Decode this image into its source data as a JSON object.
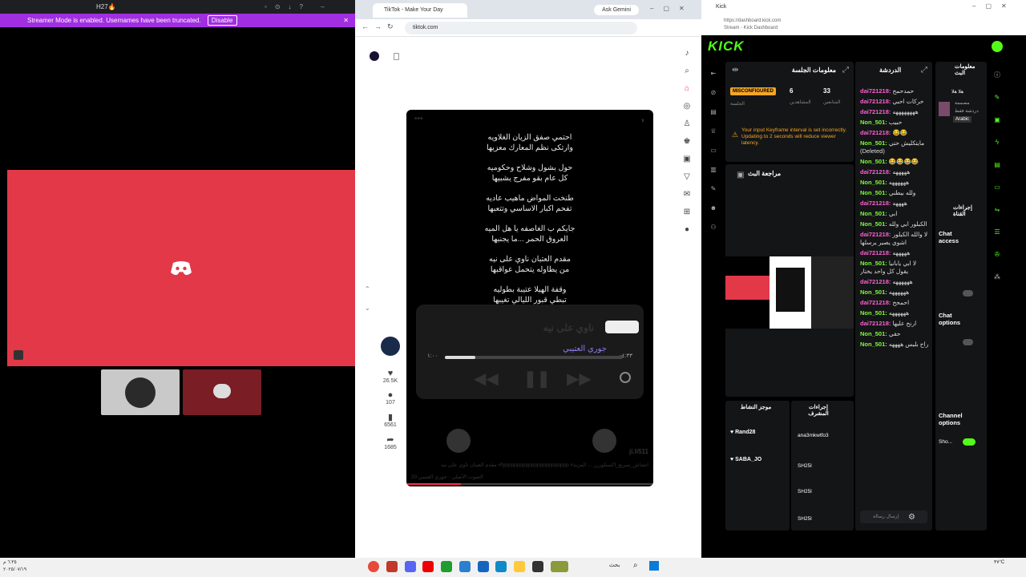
{
  "discord": {
    "window_title": "H27🔥",
    "streamer_text": "Streamer Mode is enabled. Usernames have been truncated.",
    "disable_label": "Disable"
  },
  "tiktok": {
    "tab_title": "TikTok - Make Your Day",
    "ask_gemini": "Ask Gemini",
    "url": "tiktok.com",
    "lyrics": [
      [
        "احتمي صفق الزيان الغلاويه",
        "وارتكى نظم المعارك معزيها"
      ],
      [
        "حول بشول وشلاح وحكوميه",
        "كل عام بقو مفرج يشبيها"
      ],
      [
        "طنخت المواض ماهيب عاديه",
        "تفحم اكبار الاساسي وتتعبها"
      ],
      [
        "جايكم ب الغاصفه يا هل الميه",
        "العروق الحمر ...ما يجنبها"
      ],
      [
        "مقدم العتبان ناوي على نيه",
        "من يطاوله يتحمل عواقبها"
      ],
      [
        "وقفة الهيلا عتيبة بطوليه",
        "تبطي قبور الليالي تغيبها"
      ]
    ],
    "song_title": "ناوي على نيه",
    "song_artist": "جوري العتيبي",
    "time_elapsed": "١:٠٠",
    "time_remaining": "-٤:٣٣",
    "handle": "ji.li511",
    "caption": "مقدم العتبان ناوي على نيه #fypppppppppppppppppppppp #اتشاش_سريع_اكسبلوررر ... المزيد",
    "sound": "الصوت الأصلي - جوري العتيبي 20",
    "likes": "26.5K",
    "comments": "107",
    "saves": "6561",
    "shares": "1685"
  },
  "kick": {
    "tab_title": "Kick",
    "url": "https://dashboard.kick.com",
    "page_title": "Stream - Kick Dashboard",
    "logo": "KICK",
    "session_title": "معلومات الجلسة",
    "misconfigured": "MISCONFIGURED",
    "session_label": "الجلسة",
    "followers_count": "6",
    "followers_label": "المشاهدين",
    "viewers_count": "33",
    "viewers_label": "المتابعين",
    "warning": "Your input Keyframe interval is set incorrectly. Updating to 2 seconds will reduce viewer latency.",
    "review_title": "مراجعة البث",
    "chat_title": "الدردشة",
    "stream_info_title": "معلومات البث",
    "stream_info_line1": "هلا هلا",
    "stream_info_line2": "مصممة",
    "stream_info_line3": "دردشة فقط",
    "lang": "Arabic",
    "chat": [
      {
        "user": "dai721218:",
        "text": "حمدحمح",
        "color": "#ff5fd2"
      },
      {
        "user": "dai721218:",
        "text": "حركات احبي",
        "color": "#ff5fd2"
      },
      {
        "user": "dai721218:",
        "text": "ههههههههه",
        "color": "#ff5fd2"
      },
      {
        "user": "Non_501:",
        "text": "حبيب",
        "color": "#7cfc3a"
      },
      {
        "user": "dai721218:",
        "text": "😂😂",
        "color": "#ff5fd2"
      },
      {
        "user": "Non_501:",
        "text": "مايتكليش حتي (Deleted)",
        "color": "#7cfc3a"
      },
      {
        "user": "Non_501:",
        "text": "😂😂😂😂",
        "color": "#7cfc3a"
      },
      {
        "user": "dai721218:",
        "text": "هههههه",
        "color": "#ff5fd2"
      },
      {
        "user": "Non_501:",
        "text": "ههههههه",
        "color": "#7cfc3a"
      },
      {
        "user": "Non_501:",
        "text": "ولله بيطني",
        "color": "#7cfc3a"
      },
      {
        "user": "dai721218:",
        "text": "ههههه",
        "color": "#ff5fd2"
      },
      {
        "user": "Non_501:",
        "text": "ابي",
        "color": "#7cfc3a"
      },
      {
        "user": "Non_501:",
        "text": "الكبلور ابي ولله",
        "color": "#7cfc3a"
      },
      {
        "user": "dai721218:",
        "text": "لا والله الكبلور اشوي يصير يرسلها",
        "color": "#ff5fd2"
      },
      {
        "user": "dai721218:",
        "text": "هههههه",
        "color": "#ff5fd2"
      },
      {
        "user": "Non_501:",
        "text": "لا ابي يابانيا يقول كل واحد يختار",
        "color": "#7cfc3a"
      },
      {
        "user": "dai721218:",
        "text": "ههههههه",
        "color": "#ff5fd2"
      },
      {
        "user": "Non_501:",
        "text": "ههههههه",
        "color": "#7cfc3a"
      },
      {
        "user": "dai721218:",
        "text": "احمحح",
        "color": "#ff5fd2"
      },
      {
        "user": "Non_501:",
        "text": "ههههههه",
        "color": "#7cfc3a"
      },
      {
        "user": "dai721218:",
        "text": "ارنح عليها",
        "color": "#ff5fd2"
      },
      {
        "user": "Non_501:",
        "text": "حقي",
        "color": "#7cfc3a"
      },
      {
        "user": "Non_501:",
        "text": "راح بليس ههههه",
        "color": "#7cfc3a"
      }
    ],
    "mod_actions_title": "إجراءات القناة",
    "chat_access": "Chat access",
    "chat_options": "Chat options",
    "channel_options": "Channel options",
    "show_label": "Sho...",
    "mod_col_title": "إجراءات المشرف",
    "users_col_title": "موجز النشاط",
    "mod_users": [
      "ana3mkwtfo3",
      "SH25l",
      "SH25l",
      "SH25l"
    ],
    "feed_users": [
      "Rand28",
      "SABA_JO"
    ],
    "chat_placeholder": "إرسال رسالة"
  },
  "taskbar": {
    "search_label": "بحث",
    "time": "٦:٣٥ م",
    "date": "٢٠٢٥/٠٧/١٩",
    "temp": "٣٧°C"
  }
}
